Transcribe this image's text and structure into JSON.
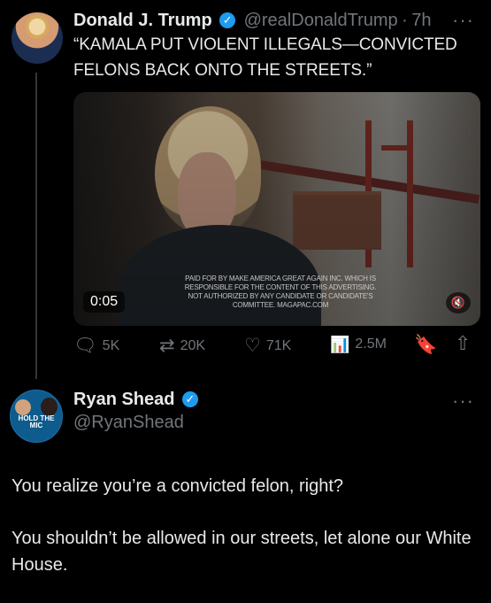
{
  "tweet1": {
    "author": "Donald J. Trump",
    "handle": "@realDonaldTrump",
    "separator": "·",
    "time": "7h",
    "more": "···",
    "text": "“KAMALA PUT VIOLENT ILLEGALS—CONVICTED FELONS BACK ONTO THE STREETS.”",
    "media": {
      "disclaimer": "PAID FOR BY MAKE AMERICA GREAT AGAIN INC. WHICH IS RESPONSIBLE FOR THE CONTENT OF THIS ADVERTISING. NOT AUTHORIZED BY ANY CANDIDATE OR CANDIDATE'S COMMITTEE. MAGAPAC.COM",
      "timestamp": "0:05",
      "mute": "🔇"
    },
    "actions": {
      "replies": "5K",
      "reposts": "20K",
      "likes": "71K",
      "views": "2.5M"
    }
  },
  "tweet2": {
    "author": "Ryan Shead",
    "handle": "@RyanShead",
    "more": "···",
    "avatar_text": "HOLD THE MIC",
    "paragraph1": "You realize you’re a convicted felon, right?",
    "paragraph2": "You shouldn’t be allowed in our streets, let alone our White House."
  },
  "icons": {
    "verified": "✓",
    "reply": "🗨",
    "repost": "⇄",
    "like": "♡",
    "views": "📊",
    "bookmark": "🔖",
    "share": "⇧"
  },
  "colors": {
    "background": "#000000",
    "text": "#e7e9ea",
    "muted": "#71767b",
    "verified": "#1d9bf0"
  }
}
